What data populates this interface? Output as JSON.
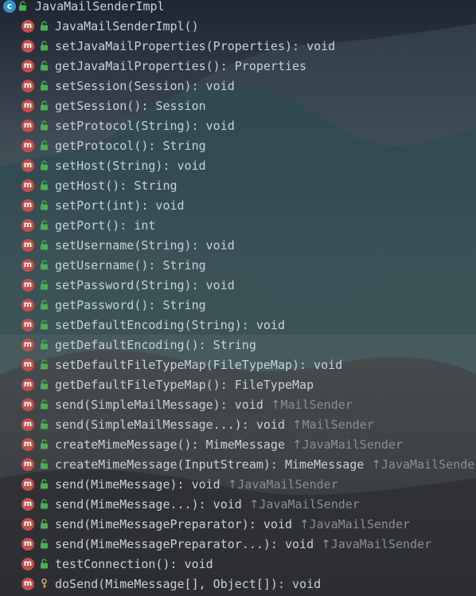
{
  "structure": {
    "class_name": "JavaMailSenderImpl",
    "members": [
      {
        "signature": "JavaMailSenderImpl()",
        "visibility": "public",
        "inherited_from": ""
      },
      {
        "signature": "setJavaMailProperties(Properties): void",
        "visibility": "public",
        "inherited_from": ""
      },
      {
        "signature": "getJavaMailProperties(): Properties",
        "visibility": "public",
        "inherited_from": ""
      },
      {
        "signature": "setSession(Session): void",
        "visibility": "public",
        "inherited_from": ""
      },
      {
        "signature": "getSession(): Session",
        "visibility": "public",
        "inherited_from": ""
      },
      {
        "signature": "setProtocol(String): void",
        "visibility": "public",
        "inherited_from": ""
      },
      {
        "signature": "getProtocol(): String",
        "visibility": "public",
        "inherited_from": ""
      },
      {
        "signature": "setHost(String): void",
        "visibility": "public",
        "inherited_from": ""
      },
      {
        "signature": "getHost(): String",
        "visibility": "public",
        "inherited_from": ""
      },
      {
        "signature": "setPort(int): void",
        "visibility": "public",
        "inherited_from": ""
      },
      {
        "signature": "getPort(): int",
        "visibility": "public",
        "inherited_from": ""
      },
      {
        "signature": "setUsername(String): void",
        "visibility": "public",
        "inherited_from": ""
      },
      {
        "signature": "getUsername(): String",
        "visibility": "public",
        "inherited_from": ""
      },
      {
        "signature": "setPassword(String): void",
        "visibility": "public",
        "inherited_from": ""
      },
      {
        "signature": "getPassword(): String",
        "visibility": "public",
        "inherited_from": ""
      },
      {
        "signature": "setDefaultEncoding(String): void",
        "visibility": "public",
        "inherited_from": ""
      },
      {
        "signature": "getDefaultEncoding(): String",
        "visibility": "public",
        "inherited_from": ""
      },
      {
        "signature": "setDefaultFileTypeMap(FileTypeMap): void",
        "visibility": "public",
        "inherited_from": ""
      },
      {
        "signature": "getDefaultFileTypeMap(): FileTypeMap",
        "visibility": "public",
        "inherited_from": ""
      },
      {
        "signature": "send(SimpleMailMessage): void",
        "visibility": "public",
        "inherited_from": "MailSender"
      },
      {
        "signature": "send(SimpleMailMessage...): void",
        "visibility": "public",
        "inherited_from": "MailSender"
      },
      {
        "signature": "createMimeMessage(): MimeMessage",
        "visibility": "public",
        "inherited_from": "JavaMailSender"
      },
      {
        "signature": "createMimeMessage(InputStream): MimeMessage",
        "visibility": "public",
        "inherited_from": "JavaMailSender"
      },
      {
        "signature": "send(MimeMessage): void",
        "visibility": "public",
        "inherited_from": "JavaMailSender"
      },
      {
        "signature": "send(MimeMessage...): void",
        "visibility": "public",
        "inherited_from": "JavaMailSender"
      },
      {
        "signature": "send(MimeMessagePreparator): void",
        "visibility": "public",
        "inherited_from": "JavaMailSender"
      },
      {
        "signature": "send(MimeMessagePreparator...): void",
        "visibility": "public",
        "inherited_from": "JavaMailSender"
      },
      {
        "signature": "testConnection(): void",
        "visibility": "public",
        "inherited_from": ""
      },
      {
        "signature": "doSend(MimeMessage[], Object[]): void",
        "visibility": "protected",
        "inherited_from": ""
      }
    ]
  },
  "icons": {
    "class_icon_glyph": "c",
    "method_icon_glyph": "m",
    "inherit_arrow": "↑"
  },
  "colors": {
    "class_icon": "#3592c4",
    "method_icon": "#c0504d",
    "public_lock": "#4caf50",
    "protected_key": "#e8c46a",
    "text": "#c9d1d9",
    "inherited_text": "#8a8f95"
  }
}
